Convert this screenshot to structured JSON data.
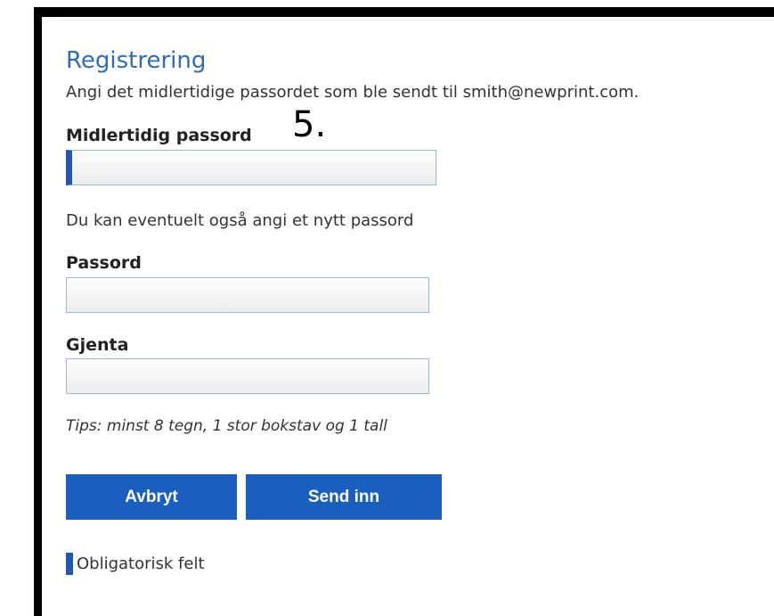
{
  "form": {
    "title": "Registrering",
    "instruction": "Angi det midlertidige passordet som ble sendt til smith@newprint.com.",
    "step_marker": "5.",
    "temp_password": {
      "label": "Midlertidig passord",
      "value": "",
      "placeholder": ""
    },
    "optional_hint": "Du kan eventuelt også angi et nytt passord",
    "password": {
      "label": "Passord",
      "value": "",
      "placeholder": ""
    },
    "repeat": {
      "label": "Gjenta",
      "value": "",
      "placeholder": ""
    },
    "tips": "Tips: minst 8 tegn, 1 stor bokstav og 1 tall",
    "cancel_label": "Avbryt",
    "submit_label": "Send inn",
    "required_legend": "Obligatorisk felt"
  },
  "colors": {
    "accent": "#1a5fbf",
    "title": "#2f6db5",
    "required_marker": "#1f57b4"
  }
}
